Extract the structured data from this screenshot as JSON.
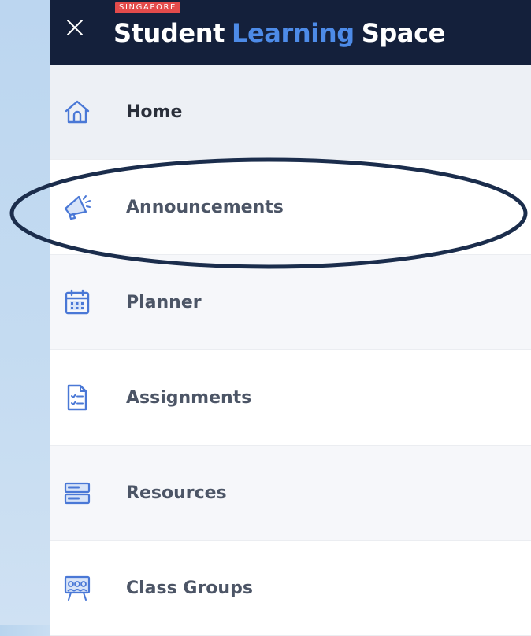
{
  "app": {
    "badge": "SINGAPORE",
    "title_part1": "Student",
    "title_part2": "Learning",
    "title_part3": "Space"
  },
  "colors": {
    "header_bg": "#14203b",
    "accent_blue": "#4d8be8",
    "badge_red": "#e34b4b",
    "icon_blue": "#4a78d6",
    "highlight_ring": "#1b2d4c"
  },
  "nav": {
    "items": [
      {
        "label": "Home",
        "icon": "home-icon"
      },
      {
        "label": "Announcements",
        "icon": "megaphone-icon"
      },
      {
        "label": "Planner",
        "icon": "calendar-icon"
      },
      {
        "label": "Assignments",
        "icon": "assignment-icon"
      },
      {
        "label": "Resources",
        "icon": "resources-icon"
      },
      {
        "label": "Class Groups",
        "icon": "class-groups-icon"
      }
    ]
  }
}
